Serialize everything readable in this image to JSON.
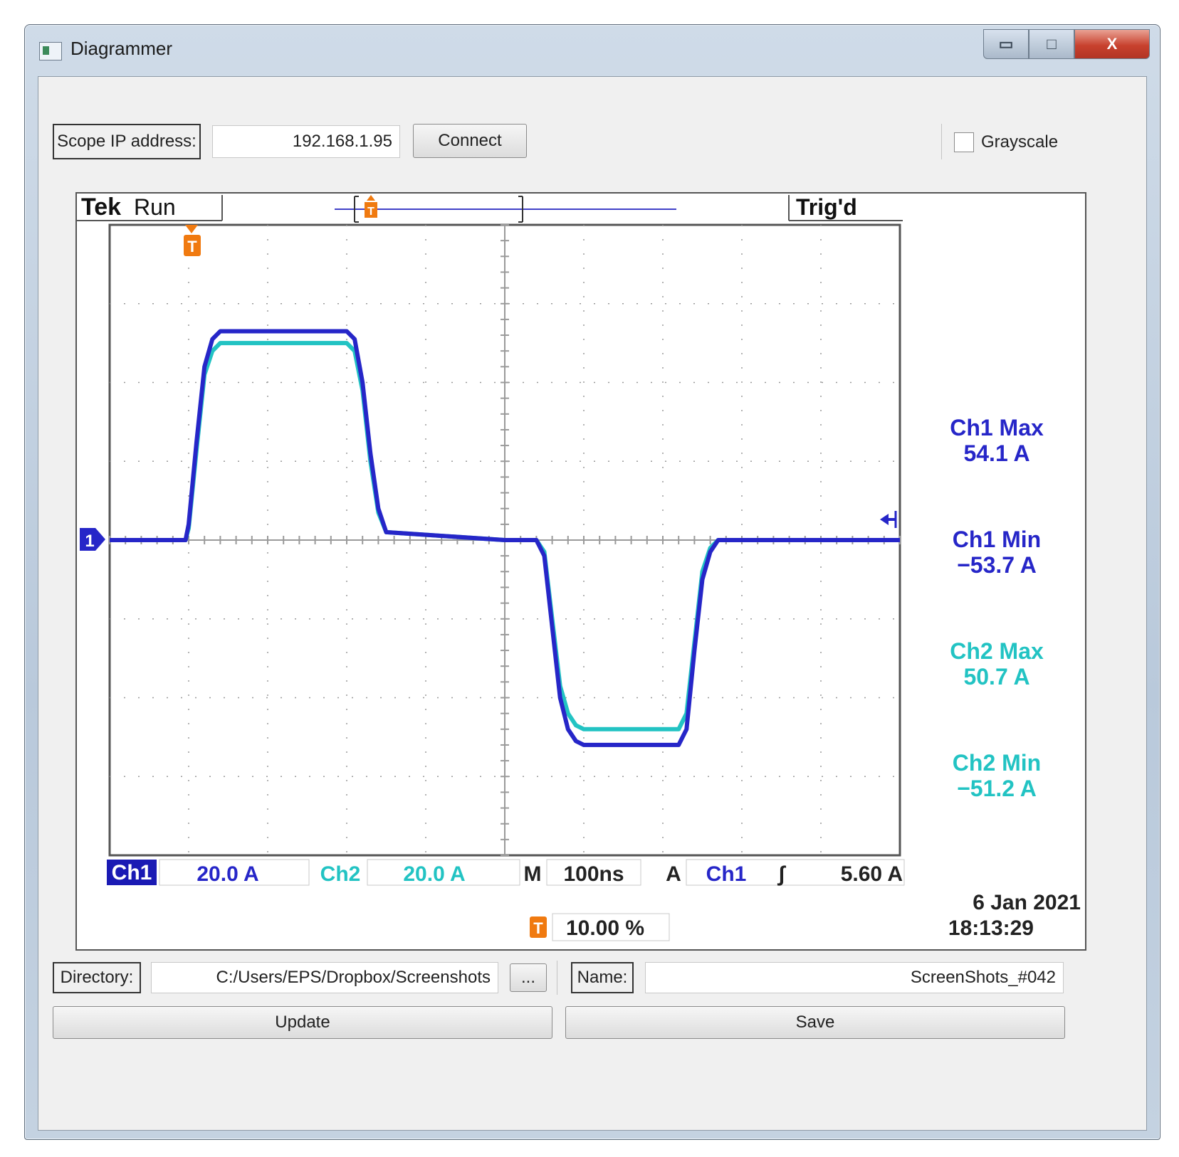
{
  "window": {
    "title": "Diagrammer",
    "buttons": {
      "minimize": "▭",
      "maximize": "□",
      "close": "X"
    }
  },
  "toolbar": {
    "ip_label": "Scope IP address:",
    "ip_value": "192.168.1.95",
    "connect_label": "Connect",
    "grayscale_label": "Grayscale",
    "grayscale_checked": false
  },
  "scope": {
    "brand": "Tek",
    "run_state": "Run",
    "trigger_state": "Trig'd",
    "trigger_marker": "T",
    "ch1_marker": "1",
    "status": {
      "ch1_label": "Ch1",
      "ch1_scale": "20.0 A",
      "ch2_label": "Ch2",
      "ch2_scale": "20.0 A",
      "m_label": "M",
      "timebase": "100ns",
      "a_label": "A",
      "trig_source": "Ch1",
      "trig_slope": "∫",
      "trig_level": "5.60 A",
      "trig_position": "10.00 %"
    },
    "date": "6 Jan  2021",
    "time": "18:13:29",
    "colors": {
      "ch1": "#2626c8",
      "ch2": "#22c3c3",
      "trigger": "#f07a10",
      "grid": "#9a9a9a"
    },
    "measurements": [
      {
        "title": "Ch1 Max",
        "value": "54.1 A",
        "color": "#2626c8"
      },
      {
        "title": "Ch1 Min",
        "value": "−53.7 A",
        "color": "#2626c8"
      },
      {
        "title": "Ch2 Max",
        "value": "50.7 A",
        "color": "#22c3c3"
      },
      {
        "title": "Ch2 Min",
        "value": "−51.2 A",
        "color": "#22c3c3"
      }
    ]
  },
  "chart_data": {
    "type": "line",
    "xlabel": "",
    "ylabel": "",
    "xlim": [
      -100,
      900
    ],
    "ylim": [
      -80,
      80
    ],
    "grid": true,
    "series": [
      {
        "name": "Ch1",
        "x": [
          -100,
          -4,
          0,
          10,
          20,
          30,
          40,
          200,
          210,
          220,
          230,
          240,
          250,
          400,
          440,
          450,
          460,
          470,
          480,
          490,
          500,
          620,
          630,
          640,
          650,
          660,
          670,
          900
        ],
        "y": [
          0,
          0,
          4,
          25,
          44,
          51,
          53,
          53,
          51,
          40,
          22,
          8,
          2,
          0,
          0,
          -4,
          -22,
          -40,
          -48,
          -51,
          -52,
          -52,
          -48,
          -28,
          -10,
          -3,
          0,
          0
        ]
      },
      {
        "name": "Ch2",
        "x": [
          -100,
          -4,
          0,
          10,
          20,
          30,
          40,
          200,
          210,
          220,
          230,
          240,
          250,
          400,
          440,
          450,
          460,
          470,
          480,
          490,
          500,
          620,
          630,
          640,
          650,
          660,
          670,
          900
        ],
        "y": [
          0,
          0,
          3,
          23,
          42,
          48,
          50,
          50,
          48,
          38,
          20,
          7,
          2,
          0,
          0,
          -3,
          -20,
          -37,
          -44,
          -47,
          -48,
          -48,
          -44,
          -26,
          -8,
          -2,
          0,
          0
        ]
      }
    ]
  },
  "footer": {
    "dir_label": "Directory:",
    "dir_value": "C:/Users/EPS/Dropbox/Screenshots",
    "browse_label": "...",
    "name_label": "Name:",
    "name_value": "ScreenShots_#042",
    "update_label": "Update",
    "save_label": "Save"
  }
}
